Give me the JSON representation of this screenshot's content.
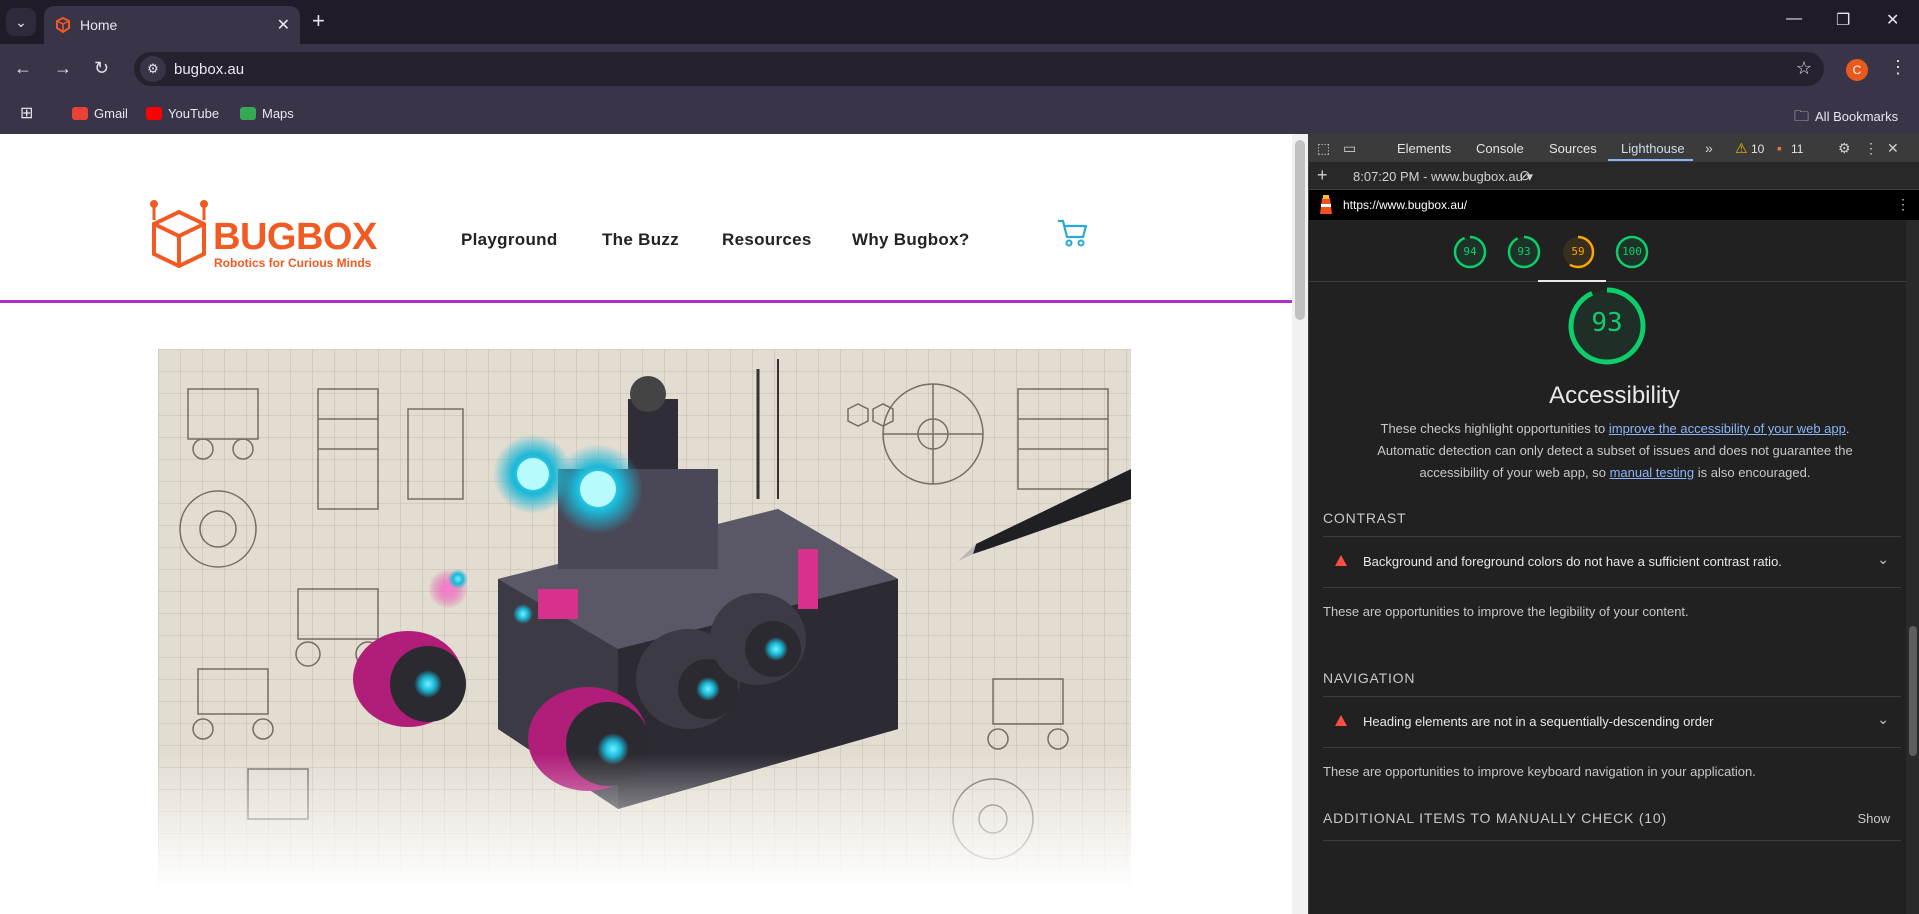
{
  "browser": {
    "tab_title": "Home",
    "url": "bugbox.au",
    "profile_initial": "C",
    "bookmarks": [
      {
        "label": "Gmail",
        "color": "#ea4335"
      },
      {
        "label": "YouTube",
        "color": "#ff0000"
      },
      {
        "label": "Maps",
        "color": "#34a853"
      }
    ],
    "all_bookmarks": "All Bookmarks"
  },
  "site": {
    "logo_text": "BUGBOX",
    "tagline": "Robotics for Curious Minds",
    "nav": [
      "Playground",
      "The Buzz",
      "Resources",
      "Why Bugbox?"
    ],
    "brand_color": "#f15a22",
    "accent_line": "#b22ec9",
    "cart_color": "#29a9d6"
  },
  "devtools": {
    "tabs": [
      "Elements",
      "Console",
      "Sources",
      "Lighthouse"
    ],
    "active_tab": "Lighthouse",
    "warnings": "10",
    "errors": "11",
    "report_selector": "8:07:20 PM - www.bugbox.au",
    "report_url": "https://www.bugbox.au/",
    "scores": [
      {
        "value": "94",
        "color": "#0cce6b"
      },
      {
        "value": "93",
        "color": "#0cce6b"
      },
      {
        "value": "59",
        "color": "#ffa400"
      },
      {
        "value": "100",
        "color": "#0cce6b"
      }
    ],
    "main_score": "93",
    "category_title": "Accessibility",
    "desc_part1": "These checks highlight opportunities to ",
    "desc_link1": "improve the accessibility of your web app",
    "desc_part2": ". Automatic detection can only detect a subset of issues and does not guarantee the accessibility of your web app, so ",
    "desc_link2": "manual testing",
    "desc_part3": " is also encouraged.",
    "groups": [
      {
        "title": "CONTRAST",
        "audit": "Background and foreground colors do not have a sufficient contrast ratio.",
        "desc": "These are opportunities to improve the legibility of your content."
      },
      {
        "title": "NAVIGATION",
        "audit": "Heading elements are not in a sequentially-descending order",
        "desc": "These are opportunities to improve keyboard navigation in your application."
      }
    ],
    "manual_title": "ADDITIONAL ITEMS TO MANUALLY CHECK (10)",
    "show_label": "Show"
  }
}
